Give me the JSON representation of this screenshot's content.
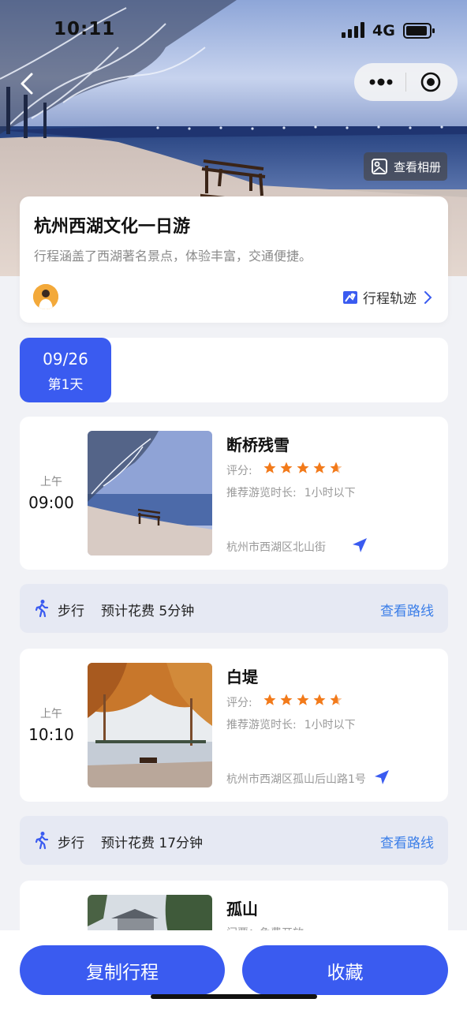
{
  "status_bar": {
    "time": "10:11",
    "network": "4G"
  },
  "hero": {
    "album_label": "查看相册"
  },
  "trip": {
    "title": "杭州西湖文化一日游",
    "description": "行程涵盖了西湖著名景点，体验丰富，交通便捷。",
    "track_label": "行程轨迹"
  },
  "day": {
    "date": "09/26",
    "label": "第1天"
  },
  "spots": [
    {
      "ampm": "上午",
      "time": "09:00",
      "name": "断桥残雪",
      "rating_label": "评分:",
      "rating": 4.5,
      "duration_label": "推荐游览时长:",
      "duration": "1小时以下",
      "address": "杭州市西湖区北山街"
    },
    {
      "ampm": "上午",
      "time": "10:10",
      "name": "白堤",
      "rating_label": "评分:",
      "rating": 4.5,
      "duration_label": "推荐游览时长:",
      "duration": "1小时以下",
      "address": "杭州市西湖区孤山后山路1号"
    },
    {
      "name": "孤山",
      "partial_text": "门票：免费开放"
    }
  ],
  "transfers": [
    {
      "mode": "步行",
      "cost": "预计花费 5分钟",
      "route_label": "查看路线"
    },
    {
      "mode": "步行",
      "cost": "预计花费 17分钟",
      "route_label": "查看路线"
    }
  ],
  "actions": {
    "copy_label": "复制行程",
    "collect_label": "收藏"
  },
  "colors": {
    "primary": "#3a5bf0",
    "star": "#f27a1a",
    "link": "#3b7ee8"
  }
}
